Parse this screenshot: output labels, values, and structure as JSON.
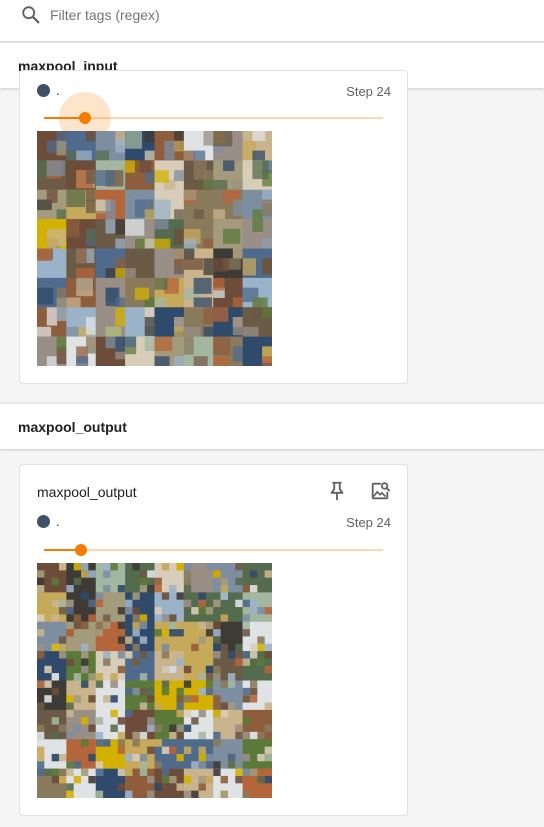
{
  "filter": {
    "placeholder": "Filter tags (regex)",
    "icon": "search-icon"
  },
  "sections": [
    {
      "title": "maxpool_input",
      "card": {
        "run_name": ".",
        "run_color": "#425066",
        "step_label": "Step 24",
        "slider_fraction": 0.12,
        "image_tag": "maxpool_input"
      }
    },
    {
      "title": "maxpool_output",
      "card": {
        "title": "maxpool_output",
        "run_name": ".",
        "run_color": "#425066",
        "step_label": "Step 24",
        "slider_fraction": 0.11,
        "pin_icon": "pin-icon",
        "inspect_icon": "image-search-icon",
        "image_tag": "maxpool_output"
      }
    }
  ],
  "colors": {
    "accent": "#f57c00",
    "accent_light": "#ffd8b0",
    "run_dot": "#425066"
  }
}
